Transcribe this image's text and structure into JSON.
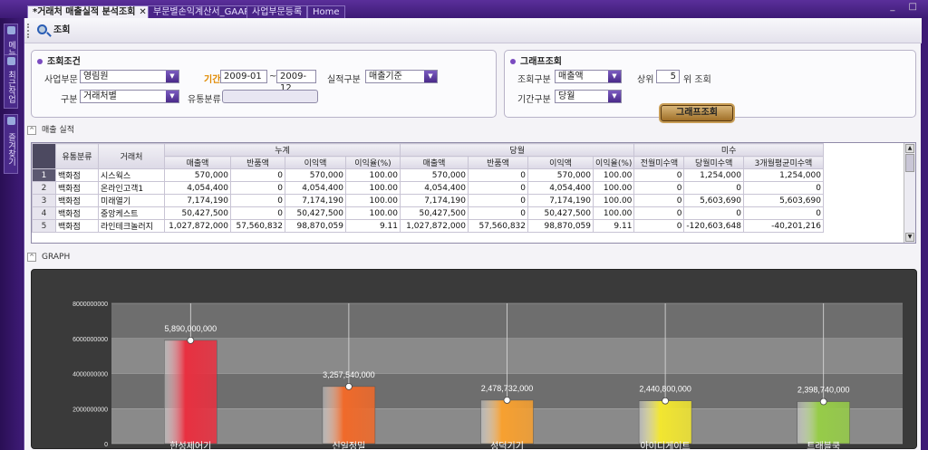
{
  "tabs": [
    {
      "label": "*거래처 매출실적 분석조회",
      "active": true,
      "closable": true
    },
    {
      "label": "부문별손익계산서_GAAP",
      "active": false,
      "closable": false
    },
    {
      "label": "사업부문등록",
      "active": false,
      "closable": false
    },
    {
      "label": "Home",
      "active": false,
      "closable": false
    }
  ],
  "window_controls": "_ □",
  "left_rail": [
    {
      "label": "메뉴",
      "icon": "menu-icon"
    },
    {
      "label": "최근작업",
      "icon": "recent-icon"
    },
    {
      "label": "즐겨찾기",
      "icon": "favorites-icon"
    }
  ],
  "toolbar": {
    "search_label": "조회"
  },
  "conditions": {
    "title": "조회조건",
    "business_label": "사업부문",
    "business_value": "영림원",
    "period_label": "기간",
    "period_from": "2009-01",
    "period_sep": "~",
    "period_to": "2009-12",
    "result_type_label": "실적구분",
    "result_type_value": "매출기준",
    "category_label": "구분",
    "category_value": "거래처별",
    "channel_label": "유통분류",
    "channel_value": ""
  },
  "graph_query": {
    "title": "그래프조회",
    "query_type_label": "조회구분",
    "query_type_value": "매출액",
    "top_label": "상위",
    "top_value": "5",
    "top_suffix": "위 조회",
    "period_type_label": "기간구분",
    "period_type_value": "당월",
    "button_label": "그래프조회"
  },
  "sales_section": {
    "label": "매출 실적",
    "toggle": "^"
  },
  "graph_section": {
    "label": "GRAPH",
    "toggle": "^"
  },
  "table": {
    "group_headers": {
      "channel": "유통분류",
      "customer": "거래처",
      "cumulative": "누계",
      "current": "당월",
      "unpaid": "미수"
    },
    "sub_headers": [
      "매출액",
      "반품액",
      "이익액",
      "이익율(%)",
      "매출액",
      "반품액",
      "이익액",
      "이익율(%)",
      "전월미수액",
      "당월미수액",
      "3개월평균미수액"
    ],
    "rows": [
      {
        "n": "1",
        "ch": "백화점",
        "cust": "시스웍스",
        "v": [
          "570,000",
          "0",
          "570,000",
          "100.00",
          "570,000",
          "0",
          "570,000",
          "100.00",
          "0",
          "1,254,000",
          "1,254,000"
        ]
      },
      {
        "n": "2",
        "ch": "백화점",
        "cust": "온라인고객1",
        "v": [
          "4,054,400",
          "0",
          "4,054,400",
          "100.00",
          "4,054,400",
          "0",
          "4,054,400",
          "100.00",
          "0",
          "0",
          "0"
        ]
      },
      {
        "n": "3",
        "ch": "백화점",
        "cust": "미래열기",
        "v": [
          "7,174,190",
          "0",
          "7,174,190",
          "100.00",
          "7,174,190",
          "0",
          "7,174,190",
          "100.00",
          "0",
          "5,603,690",
          "5,603,690"
        ]
      },
      {
        "n": "4",
        "ch": "백화점",
        "cust": "중앙케스트",
        "v": [
          "50,427,500",
          "0",
          "50,427,500",
          "100.00",
          "50,427,500",
          "0",
          "50,427,500",
          "100.00",
          "0",
          "0",
          "0"
        ]
      },
      {
        "n": "5",
        "ch": "백화점",
        "cust": "라인테크놀러지",
        "v": [
          "1,027,872,000",
          "57,560,832",
          "98,870,059",
          "9.11",
          "1,027,872,000",
          "57,560,832",
          "98,870,059",
          "9.11",
          "0",
          "-120,603,648",
          "-40,201,216"
        ]
      }
    ]
  },
  "chart_data": {
    "type": "bar",
    "categories": [
      "한성제어기",
      "신일정밀",
      "성덕기기",
      "아이디게이트",
      "트래블쿡"
    ],
    "values": [
      5890000000,
      3257540000,
      2478732000,
      2440800000,
      2398740000
    ],
    "value_labels": [
      "5,890,000,000",
      "3,257,540,000",
      "2,478,732,000",
      "2,440,800,000",
      "2,398,740,000"
    ],
    "y_ticks": [
      0,
      2000000000,
      4000000000,
      6000000000,
      8000000000
    ],
    "y_tick_labels": [
      "0",
      "2000000000",
      "4000000000",
      "6000000000",
      "8000000000"
    ],
    "ylim": [
      0,
      8000000000
    ],
    "bar_colors": [
      "#e83040",
      "#f06a2a",
      "#f7a030",
      "#f2e630",
      "#96cc48"
    ],
    "plot_bg": "#8c8c8c",
    "grid": true
  }
}
